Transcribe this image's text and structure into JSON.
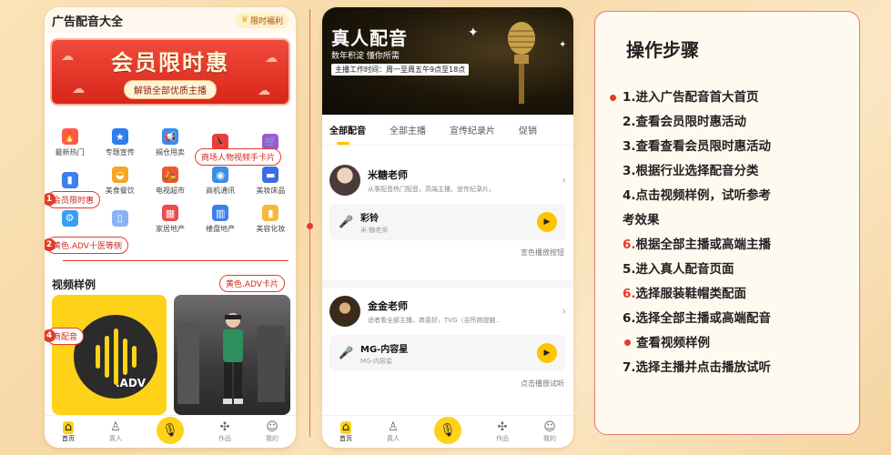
{
  "phone1": {
    "header": {
      "title": "广告配音大全",
      "vip_label": "限时福利"
    },
    "banner": {
      "title": "会员限时惠",
      "subtitle": "解锁全部优质主播"
    },
    "categories": [
      [
        {
          "label": "最新热门",
          "icon": "fire-icon",
          "color": "#ff5a4a"
        },
        {
          "label": "专题宣传",
          "icon": "star-badge-icon",
          "color": "#2d7ef0"
        },
        {
          "label": "揭仓甩卖",
          "icon": "megaphone-icon",
          "color": "#3b8cf5"
        },
        {
          "label": "",
          "icon": "high-heel-icon",
          "color": "#ee3b3b"
        },
        {
          "label": "",
          "icon": "shopping-cart-icon",
          "color": "#9b59d6"
        }
      ],
      [
        {
          "label": "",
          "icon": "phone-icon",
          "color": "#3b7ff2"
        },
        {
          "label": "美食餐饮",
          "icon": "dish-icon",
          "color": "#f5a623"
        },
        {
          "label": "电视超市",
          "icon": "scooter-icon",
          "color": "#f0562d"
        },
        {
          "label": "商机通讯",
          "icon": "washer-icon",
          "color": "#3a8de8"
        },
        {
          "label": "美妆床品",
          "icon": "bed-icon",
          "color": "#3b6fe0"
        }
      ],
      [
        {
          "label": "",
          "icon": "stroller-icon",
          "color": "#3b9ef0"
        },
        {
          "label": "",
          "icon": "fridge-icon",
          "color": "#8ab1f5"
        },
        {
          "label": "家居地产",
          "icon": "building-icon",
          "color": "#ef4a4a"
        },
        {
          "label": "楼盘地产",
          "icon": "tower-icon",
          "color": "#3b7ff2"
        },
        {
          "label": "美容化妆",
          "icon": "bottle-icon",
          "color": "#f5b93a"
        }
      ]
    ],
    "callouts": {
      "c_top": "商场人物视频手卡片",
      "c1": "会员限时惠",
      "c2": "黄色.ADV十医等侧",
      "c_video": "黄色.ADV卡片",
      "c4": "商配音"
    },
    "callout_numbers": {
      "n1": "1",
      "n2": "2",
      "n4": "4"
    },
    "video_section_title": "视频样例",
    "thumb_a_text": ".ADV",
    "tabs": [
      {
        "label": "首页",
        "icon": "home-icon"
      },
      {
        "label": "真人",
        "icon": "person-icon"
      },
      {
        "label": "",
        "icon": "mic-icon"
      },
      {
        "label": "作品",
        "icon": "grid-icon"
      },
      {
        "label": "我的",
        "icon": "smile-icon"
      }
    ]
  },
  "phone2": {
    "banner": {
      "title": "真人配音",
      "subtitle": "数年积淀 懂你所需",
      "hours": "主播工作时间：周一至周五午9点至18点"
    },
    "tabs": [
      "全部配音",
      "全部主播",
      "宣传纪录片",
      "促销"
    ],
    "teachers": [
      {
        "name": "米糖老师",
        "desc": "从事配音热门配音，高端主播，宣传纪录片。",
        "sample_title": "彩铃",
        "sample_sub": "米·糖老师",
        "foot": "宣色播放按钮"
      },
      {
        "name": "金金老师",
        "desc": "适者看全部主播，商喜好，TVG（吉所商提脑..",
        "sample_title": "MG-内容星",
        "sample_sub": "MG-内容星",
        "foot": "点击播放试听"
      }
    ],
    "tabbar": [
      {
        "label": "首页",
        "icon": "home-icon"
      },
      {
        "label": "真人",
        "icon": "person-icon"
      },
      {
        "label": "",
        "icon": "mic-icon"
      },
      {
        "label": "作品",
        "icon": "grid-icon"
      },
      {
        "label": "我的",
        "icon": "smile-icon"
      }
    ]
  },
  "steps": {
    "title": "操作步骤",
    "items": [
      {
        "num": "1.",
        "text": "进入广告配音首大首页",
        "num_red": false,
        "bullet": true
      },
      {
        "num": "2.",
        "text": "查看会员限时惠活动",
        "num_red": false,
        "bullet": false
      },
      {
        "num": "3.",
        "text": "查看查看会员限时惠活动",
        "num_red": false,
        "bullet": false
      },
      {
        "num": "3.",
        "text": "根据行业选择配音分类",
        "num_red": false,
        "bullet": false
      },
      {
        "num": "4.",
        "text": "点击视频样例，试听参考",
        "num_red": false,
        "bullet": false
      },
      {
        "num": "",
        "text": "考效果",
        "num_red": false,
        "bullet": false
      },
      {
        "num": "6.",
        "text": "根据全部主播或高端主播",
        "num_red": true,
        "bullet": false
      },
      {
        "num": "5.",
        "text": "进入真人配音页面",
        "num_red": false,
        "bullet": false
      },
      {
        "num": "6.",
        "text": "选择服装鞋帽类配面",
        "num_red": true,
        "bullet": false
      },
      {
        "num": "6.",
        "text": "选择全部主播或高端配音",
        "num_red": false,
        "bullet": false
      },
      {
        "num": "",
        "text": "查看视频样例",
        "num_red": false,
        "bullet": false,
        "dot": true
      },
      {
        "num": "7.",
        "text": "选择主播并点击播放试听",
        "num_red": false,
        "bullet": false
      }
    ]
  },
  "colors": {
    "accent_red": "#e53a2a",
    "accent_yellow": "#ffc400",
    "background": "#f9deb0"
  }
}
